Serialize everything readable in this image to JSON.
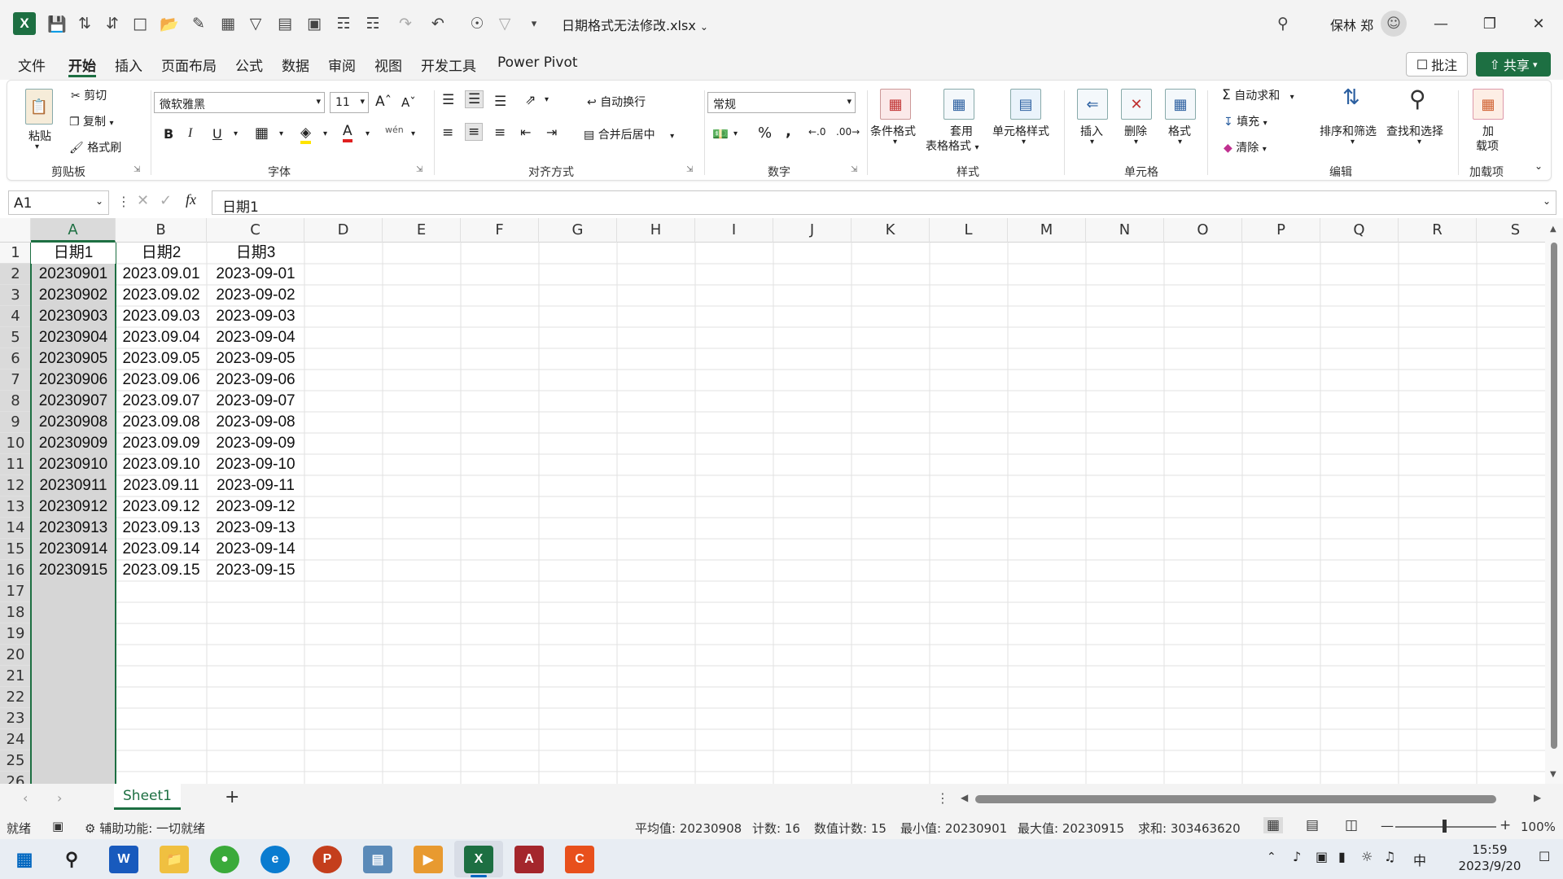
{
  "titlebar": {
    "app": "X",
    "document_title": "日期格式无法修改.xlsx",
    "user_name": "保林 郑"
  },
  "tabs": [
    "文件",
    "开始",
    "插入",
    "页面布局",
    "公式",
    "数据",
    "审阅",
    "视图",
    "开发工具",
    "Power Pivot"
  ],
  "active_tab": "开始",
  "actions": {
    "comment": "批注",
    "share": "共享"
  },
  "ribbon": {
    "clipboard": {
      "paste": "粘贴",
      "cut": "剪切",
      "copy": "复制",
      "format_painter": "格式刷",
      "group": "剪贴板"
    },
    "font": {
      "name": "微软雅黑",
      "size": "11",
      "group": "字体"
    },
    "alignment": {
      "wrap": "自动换行",
      "merge": "合并后居中",
      "group": "对齐方式"
    },
    "number": {
      "format": "常规",
      "group": "数字"
    },
    "styles": {
      "conditional": "条件格式",
      "table_l1": "套用",
      "table_l2": "表格格式",
      "cell_styles": "单元格样式",
      "group": "样式"
    },
    "cells": {
      "insert": "插入",
      "delete": "删除",
      "format": "格式",
      "group": "单元格"
    },
    "editing": {
      "autosum": "自动求和",
      "fill": "填充",
      "clear": "清除",
      "sort": "排序和筛选",
      "find": "查找和选择",
      "group": "编辑"
    },
    "addins": {
      "label_l1": "加",
      "label_l2": "载项",
      "group": "加载项"
    }
  },
  "formula_bar": {
    "name_box": "A1",
    "fx": "fx",
    "content": "日期1"
  },
  "columns": [
    "A",
    "B",
    "C",
    "D",
    "E",
    "F",
    "G",
    "H",
    "I",
    "J",
    "K",
    "L",
    "M",
    "N",
    "O",
    "P",
    "Q",
    "R",
    "S"
  ],
  "rows": [
    "1",
    "2",
    "3",
    "4",
    "5",
    "6",
    "7",
    "8",
    "9",
    "10",
    "11",
    "12",
    "13",
    "14",
    "15",
    "16",
    "17",
    "18",
    "19",
    "20",
    "21",
    "22",
    "23",
    "24",
    "25",
    "26"
  ],
  "table": {
    "headers": [
      "日期1",
      "日期2",
      "日期3"
    ],
    "rows": [
      [
        "20230901",
        "2023.09.01",
        "2023-09-01"
      ],
      [
        "20230902",
        "2023.09.02",
        "2023-09-02"
      ],
      [
        "20230903",
        "2023.09.03",
        "2023-09-03"
      ],
      [
        "20230904",
        "2023.09.04",
        "2023-09-04"
      ],
      [
        "20230905",
        "2023.09.05",
        "2023-09-05"
      ],
      [
        "20230906",
        "2023.09.06",
        "2023-09-06"
      ],
      [
        "20230907",
        "2023.09.07",
        "2023-09-07"
      ],
      [
        "20230908",
        "2023.09.08",
        "2023-09-08"
      ],
      [
        "20230909",
        "2023.09.09",
        "2023-09-09"
      ],
      [
        "20230910",
        "2023.09.10",
        "2023-09-10"
      ],
      [
        "20230911",
        "2023.09.11",
        "2023-09-11"
      ],
      [
        "20230912",
        "2023.09.12",
        "2023-09-12"
      ],
      [
        "20230913",
        "2023.09.13",
        "2023-09-13"
      ],
      [
        "20230914",
        "2023.09.14",
        "2023-09-14"
      ],
      [
        "20230915",
        "2023.09.15",
        "2023-09-15"
      ]
    ]
  },
  "sheet_tab": "Sheet1",
  "status": {
    "mode": "就绪",
    "accessibility": "辅助功能: 一切就绪",
    "average": "平均值: 20230908",
    "count": "计数: 16",
    "numeric_count": "数值计数: 15",
    "min": "最小值: 20230901",
    "max": "最大值: 20230915",
    "sum": "求和: 303463620",
    "zoom": "100%"
  },
  "taskbar": {
    "time": "15:59",
    "date": "2023/9/20",
    "ime": "中"
  },
  "colors": {
    "excel_green": "#1d6f42",
    "selection_gray": "#d6d6d6"
  }
}
